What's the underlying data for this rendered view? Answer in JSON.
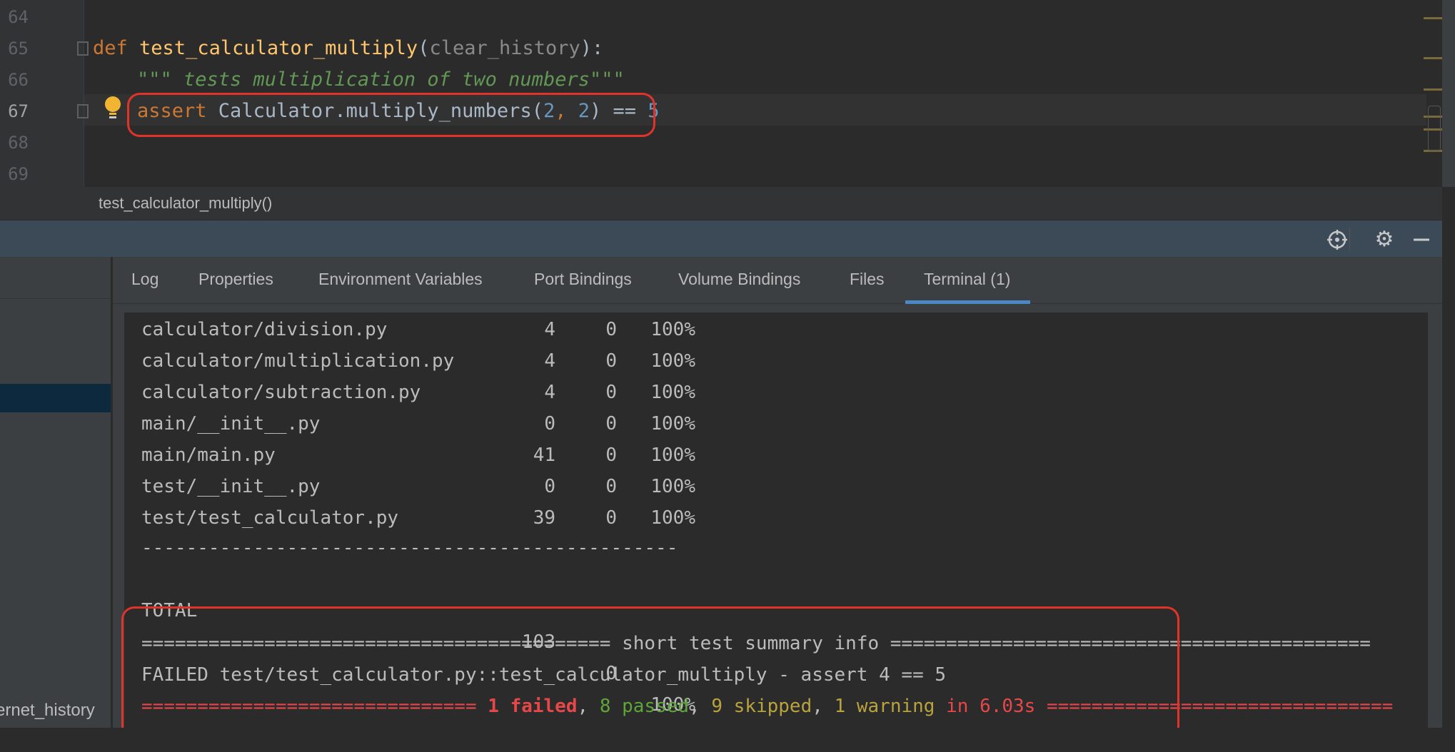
{
  "editor": {
    "lines": [
      {
        "number": "64"
      },
      {
        "number": "65",
        "def_kw": "def",
        "fn_name": "test_calculator_multiply",
        "open_paren": "(",
        "param": "clear_history",
        "close": "):"
      },
      {
        "number": "66",
        "docstring": "\"\"\" tests multiplication of two numbers\"\"\""
      },
      {
        "number": "67",
        "assert_kw": "assert",
        "call": " Calculator.multiply_numbers(",
        "arg1": "2",
        "comma": ", ",
        "arg2": "2",
        "rest": ") == ",
        "expected": "5"
      },
      {
        "number": "68"
      },
      {
        "number": "69"
      }
    ],
    "bulb_icon": "lightbulb-icon"
  },
  "breadcrumb": {
    "label": "test_calculator_multiply()"
  },
  "tool_header": {
    "icons": [
      "crosshair-icon",
      "gear-icon",
      "minimize-icon"
    ]
  },
  "left_pane": {
    "item_label": "ernet_history"
  },
  "tabs": [
    {
      "label": "Log"
    },
    {
      "label": "Properties"
    },
    {
      "label": "Environment Variables"
    },
    {
      "label": "Port Bindings"
    },
    {
      "label": "Volume Bindings"
    },
    {
      "label": "Files"
    },
    {
      "label": "Terminal (1)",
      "active": true
    }
  ],
  "terminal": {
    "coverage_rows": [
      {
        "name": "calculator/division.py",
        "stmts": "4",
        "miss": "0",
        "cover": "100%"
      },
      {
        "name": "calculator/multiplication.py",
        "stmts": "4",
        "miss": "0",
        "cover": "100%"
      },
      {
        "name": "calculator/subtraction.py",
        "stmts": "4",
        "miss": "0",
        "cover": "100%"
      },
      {
        "name": "main/__init__.py",
        "stmts": "0",
        "miss": "0",
        "cover": "100%"
      },
      {
        "name": "main/main.py",
        "stmts": "41",
        "miss": "0",
        "cover": "100%"
      },
      {
        "name": "test/__init__.py",
        "stmts": "0",
        "miss": "0",
        "cover": "100%"
      },
      {
        "name": "test/test_calculator.py",
        "stmts": "39",
        "miss": "0",
        "cover": "100%"
      }
    ],
    "separator": "------------------------------------------------",
    "total": {
      "name": "TOTAL",
      "stmts": "103",
      "miss": "0",
      "cover": "100%"
    },
    "summary_header": "========================================== short test summary info ===========================================",
    "failed_line": "FAILED test/test_calculator.py::test_calculator_multiply - assert 4 == 5",
    "result": {
      "prefix": "============================== ",
      "failed": "1 failed",
      "sep1": ", ",
      "passed": "8 passed",
      "sep2": ", ",
      "skipped": "9 skipped",
      "sep3": ", ",
      "warning": "1 warning",
      "time": " in 6.03s",
      "suffix": " ==============================="
    }
  },
  "colors": {
    "highlight_box": "#e0342a",
    "active_tab": "#4a88c7",
    "failed": "#e8474a",
    "passed": "#5ea53a",
    "skipped": "#b8a33c"
  }
}
